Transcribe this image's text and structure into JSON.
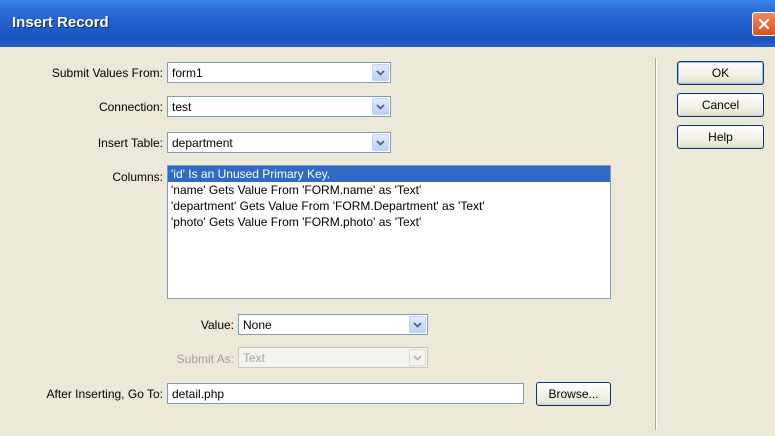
{
  "dialog": {
    "title": "Insert Record",
    "close_icon": "close-icon"
  },
  "form": {
    "submit_values_from": {
      "label": "Submit Values From:",
      "value": "form1"
    },
    "connection": {
      "label": "Connection:",
      "value": "test"
    },
    "insert_table": {
      "label": "Insert Table:",
      "value": "department"
    },
    "columns": {
      "label": "Columns:",
      "items": [
        {
          "text": "'id' Is an Unused Primary Key.",
          "selected": true
        },
        {
          "text": "'name' Gets Value From 'FORM.name' as 'Text'",
          "selected": false
        },
        {
          "text": "'department' Gets Value From 'FORM.Department' as 'Text'",
          "selected": false
        },
        {
          "text": "'photo' Gets Value From 'FORM.photo' as 'Text'",
          "selected": false
        }
      ]
    },
    "value": {
      "label": "Value:",
      "value": "None"
    },
    "submit_as": {
      "label": "Submit As:",
      "value": "Text",
      "disabled": true
    },
    "after_inserting": {
      "label": "After Inserting, Go To:",
      "value": "detail.php"
    },
    "browse_label": "Browse..."
  },
  "buttons": {
    "ok": "OK",
    "cancel": "Cancel",
    "help": "Help"
  },
  "colors": {
    "title_bar": "#1f5cc8",
    "selection": "#316ac5",
    "dialog_bg": "#ece9d8"
  }
}
